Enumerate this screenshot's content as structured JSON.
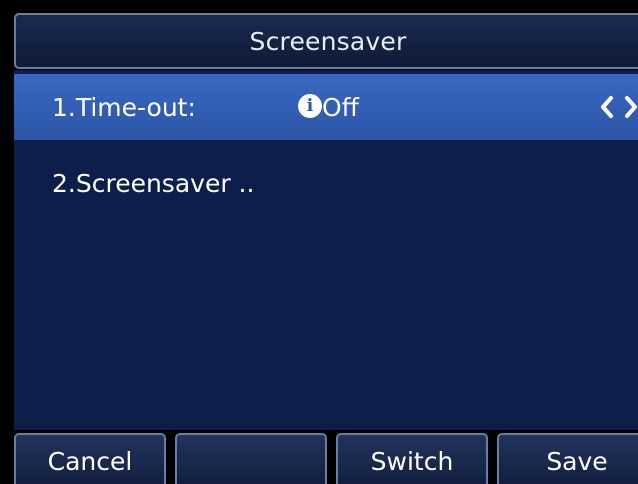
{
  "header": {
    "title": "Screensaver"
  },
  "menu": {
    "items": [
      {
        "label": "1.Time-out:",
        "value": "Off",
        "selected": true,
        "icon": "info-icon"
      },
      {
        "label": "2.Screensaver ..",
        "selected": false
      }
    ]
  },
  "softkeys": {
    "key1": "Cancel",
    "key2": "",
    "key3": "Switch",
    "key4": "Save"
  },
  "colors": {
    "background": "#0d1e4a",
    "selected": "#2f5db4",
    "border": "#6a7da3",
    "text": "#ffffff"
  }
}
